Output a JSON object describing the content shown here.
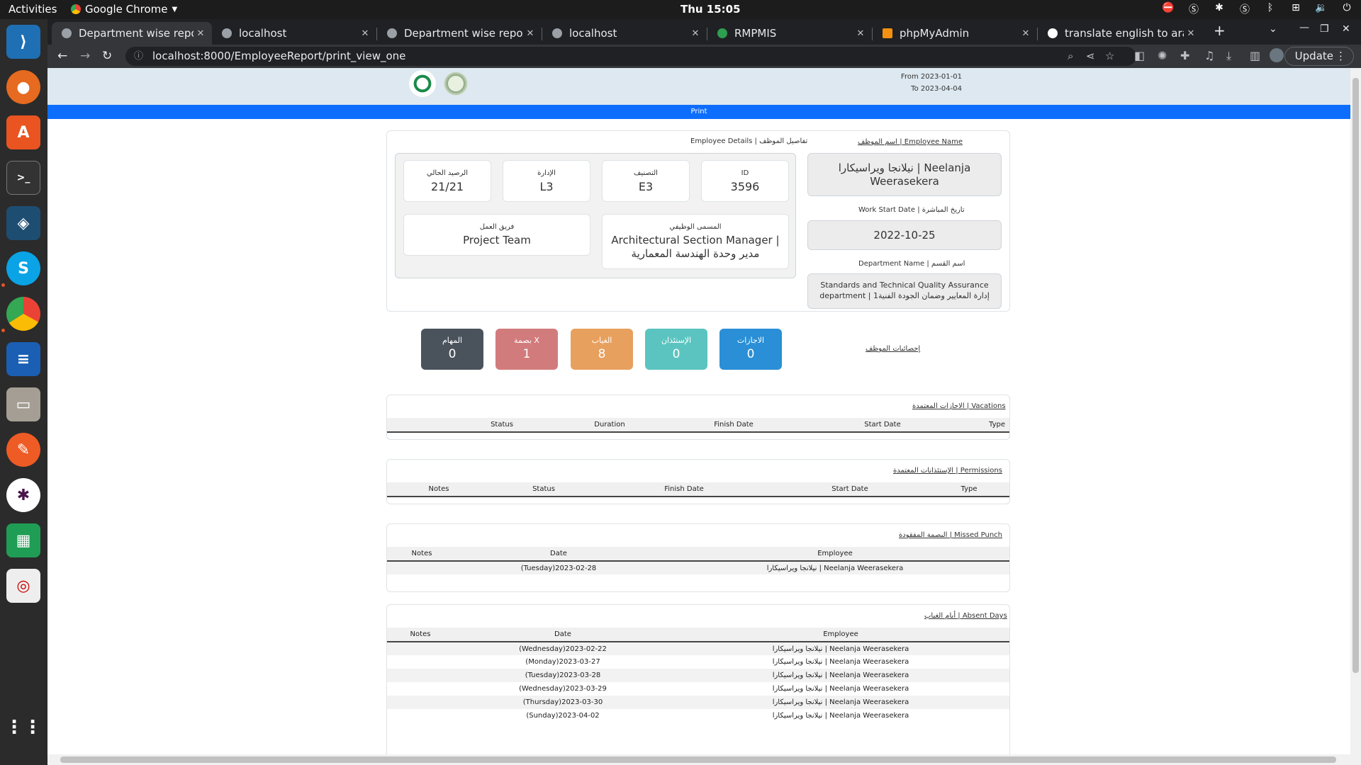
{
  "topbar": {
    "activities": "Activities",
    "app": "Google Chrome",
    "clock": "Thu 15:05"
  },
  "tabs": [
    {
      "title": "Department wise report"
    },
    {
      "title": "localhost"
    },
    {
      "title": "Department wise report"
    },
    {
      "title": "localhost"
    },
    {
      "title": "RMPMIS"
    },
    {
      "title": "phpMyAdmin"
    },
    {
      "title": "translate english to arab"
    }
  ],
  "address": {
    "url": "localhost:8000/EmployeeReport/print_view_one"
  },
  "update_label": "Update",
  "header": {
    "from": "From 2023-01-01",
    "to": "To 2023-04-04",
    "print": "Print"
  },
  "employee": {
    "details_label": "Employee Details | تفاصيل الموظف",
    "name_label": "اسم الموظف | Employee Name",
    "name": "نيلانجا ويراسيكارا | Neelanja Weerasekera",
    "start_label": "Work Start Date | تاريخ المباشرة",
    "start": "2022-10-25",
    "dept_label": "Department Name | اسم القسم",
    "dept": "Standards and Technical Quality Assurance department | إدارة المعايير وضمان الجودة الفنية1",
    "boxes": [
      {
        "k": "الرصيد الحالي",
        "v": "21/21"
      },
      {
        "k": "الإدارة",
        "v": "L3"
      },
      {
        "k": "التصنيف",
        "v": "E3"
      },
      {
        "k": "ID",
        "v": "3596"
      }
    ],
    "team_k": "فريق العمل",
    "team_v": "Project Team",
    "title_k": "المسمى الوظيفي",
    "title_v": "Architectural Section Manager | مدير وحدة الهندسة المعمارية"
  },
  "stats": {
    "label": "إحصائيات الموظف",
    "items": [
      {
        "k": "المهام",
        "v": "0",
        "color": "#4a535c"
      },
      {
        "k": "بصمة X",
        "v": "1",
        "color": "#d27b7c"
      },
      {
        "k": "الغياب",
        "v": "8",
        "color": "#e8a05e"
      },
      {
        "k": "الإستئذان",
        "v": "0",
        "color": "#5bc4c0"
      },
      {
        "k": "الاجازات",
        "v": "0",
        "color": "#2a8fd6"
      }
    ]
  },
  "vacations": {
    "label": "الاجازات المعتمدة | Vacations",
    "cols": [
      "Status",
      "Duration",
      "Finish Date",
      "Start Date",
      "Type"
    ]
  },
  "permissions": {
    "label": "الإستئذانات المعتمدة | Permissions",
    "cols": [
      "Notes",
      "Status",
      "Finish Date",
      "Start Date",
      "Type"
    ]
  },
  "missed": {
    "label": "البصمة المفقودة | Missed Punch",
    "cols": [
      "Notes",
      "Date",
      "Employee"
    ],
    "rows": [
      {
        "notes": "",
        "date": "(Tuesday)2023-02-28",
        "emp": "نيلانجا ويراسيكارا | Neelanja Weerasekera"
      }
    ]
  },
  "absent": {
    "label": "أيام الغياب | Absent Days",
    "cols": [
      "Notes",
      "Date",
      "Employee"
    ],
    "rows": [
      {
        "notes": "",
        "date": "(Wednesday)2023-02-22",
        "emp": "نيلانجا ويراسيكارا | Neelanja Weerasekera"
      },
      {
        "notes": "",
        "date": "(Monday)2023-03-27",
        "emp": "نيلانجا ويراسيكارا | Neelanja Weerasekera"
      },
      {
        "notes": "",
        "date": "(Tuesday)2023-03-28",
        "emp": "نيلانجا ويراسيكارا | Neelanja Weerasekera"
      },
      {
        "notes": "",
        "date": "(Wednesday)2023-03-29",
        "emp": "نيلانجا ويراسيكارا | Neelanja Weerasekera"
      },
      {
        "notes": "",
        "date": "(Thursday)2023-03-30",
        "emp": "نيلانجا ويراسيكارا | Neelanja Weerasekera"
      },
      {
        "notes": "",
        "date": "(Sunday)2023-04-02",
        "emp": "نيلانجا ويراسيكارا | Neelanja Weerasekera"
      }
    ]
  }
}
